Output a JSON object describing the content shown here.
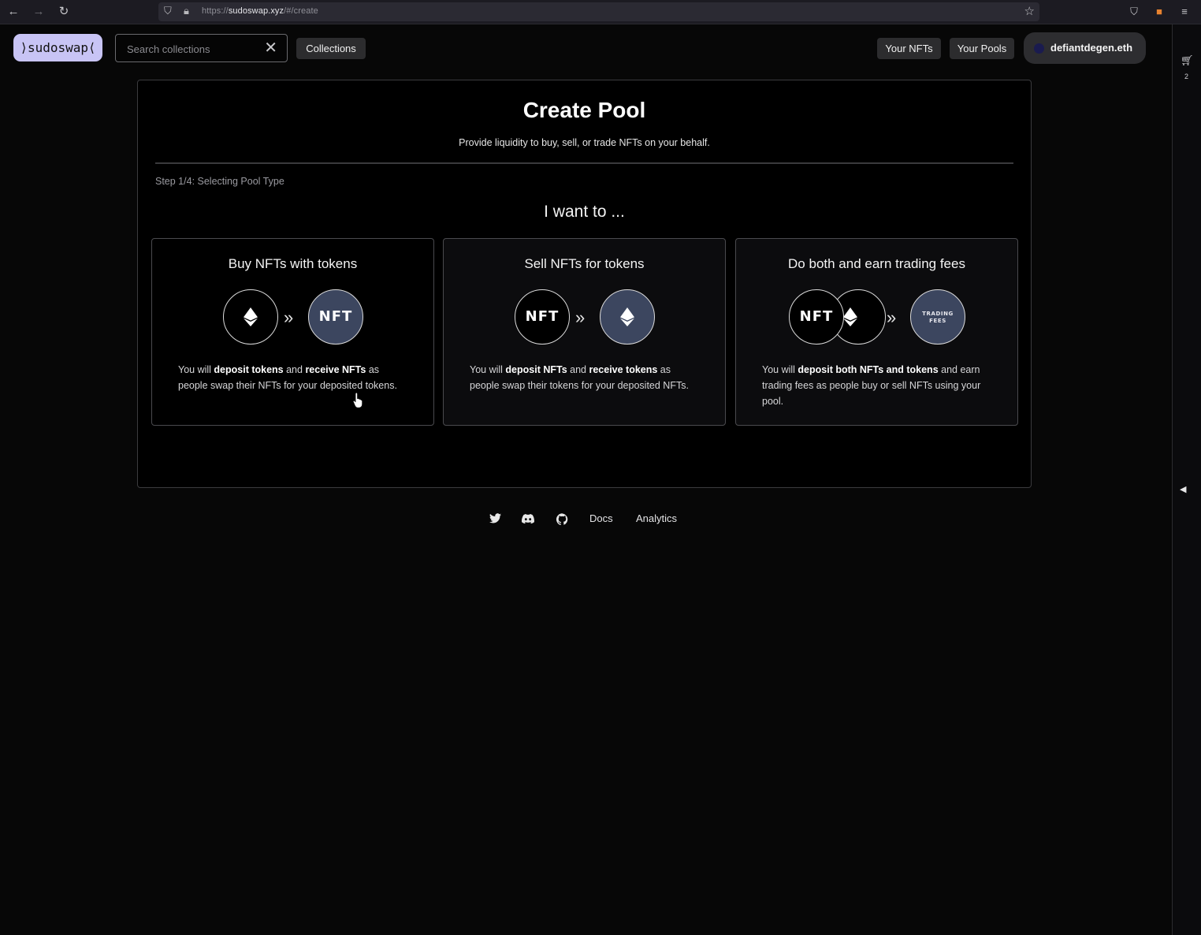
{
  "browser": {
    "url_prefix": "https://",
    "url_host": "sudoswap.xyz",
    "url_path": "/#/create"
  },
  "header": {
    "logo_text": "⟩sudoswap⟨",
    "search_placeholder": "Search collections",
    "collections_label": "Collections",
    "your_nfts_label": "Your NFTs",
    "your_pools_label": "Your Pools",
    "wallet_name": "defiantdegen.eth"
  },
  "sidebar": {
    "cart_count": "2"
  },
  "main": {
    "title": "Create Pool",
    "subtitle": "Provide liquidity to buy, sell, or trade NFTs on your behalf.",
    "step_label": "Step 1/4: Selecting Pool Type",
    "prompt": "I want to ...",
    "cards": [
      {
        "title": "Buy NFTs with tokens",
        "desc": [
          {
            "t": "You will ",
            "b": false
          },
          {
            "t": "deposit tokens",
            "b": true
          },
          {
            "t": " and ",
            "b": false
          },
          {
            "t": "receive NFTs",
            "b": true
          },
          {
            "t": " as people swap their NFTs for your deposited tokens.",
            "b": false
          }
        ]
      },
      {
        "title": "Sell NFTs for tokens",
        "desc": [
          {
            "t": "You will ",
            "b": false
          },
          {
            "t": "deposit NFTs",
            "b": true
          },
          {
            "t": " and ",
            "b": false
          },
          {
            "t": "receive tokens",
            "b": true
          },
          {
            "t": " as people swap their tokens for your deposited NFTs.",
            "b": false
          }
        ]
      },
      {
        "title": "Do both and earn trading fees",
        "desc": [
          {
            "t": "You will ",
            "b": false
          },
          {
            "t": "deposit both NFTs and tokens",
            "b": true
          },
          {
            "t": " and earn trading fees as people buy or sell NFTs using your pool.",
            "b": false
          }
        ]
      }
    ],
    "badges": {
      "nft": "NFT",
      "fees_line1": "TRADING",
      "fees_line2": "FEES"
    }
  },
  "footer": {
    "docs_label": "Docs",
    "analytics_label": "Analytics"
  },
  "colors": {
    "accent_logo": "#c8c4f5",
    "badge_slate": "#3c465f"
  }
}
